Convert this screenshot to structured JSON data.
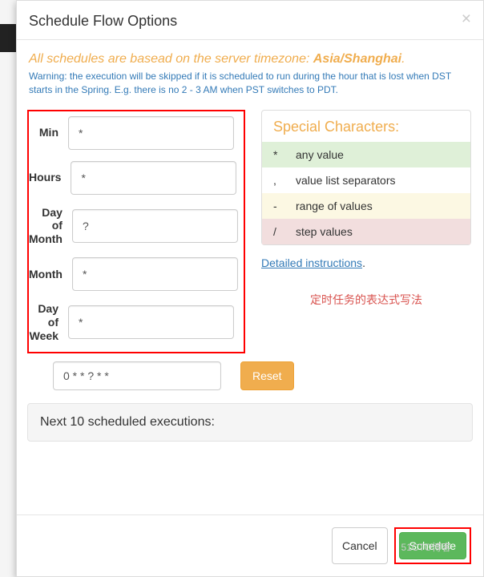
{
  "modal": {
    "title": "Schedule Flow Options",
    "close": "×"
  },
  "notice": {
    "tz_prefix": "All schedules are basead on the server timezone: ",
    "tz_name": "Asia/Shanghai",
    "tz_suffix": ".",
    "dst_warning": "Warning: the execution will be skipped if it is scheduled to run during the hour that is lost when DST starts in the Spring. E.g. there is no 2 - 3 AM when PST switches to PDT."
  },
  "cron": {
    "fields": [
      {
        "label": "Min",
        "value": "*"
      },
      {
        "label": "Hours",
        "value": "*"
      },
      {
        "label": "Day of Month",
        "value": "?"
      },
      {
        "label": "Month",
        "value": "*"
      },
      {
        "label": "Day of Week",
        "value": "*"
      }
    ],
    "summary": "0 * * ? * *",
    "reset_label": "Reset"
  },
  "special": {
    "title": "Special Characters:",
    "rows": [
      {
        "char": "*",
        "desc": "any value"
      },
      {
        "char": ",",
        "desc": "value list separators"
      },
      {
        "char": "-",
        "desc": "range of values"
      },
      {
        "char": "/",
        "desc": "step values"
      }
    ],
    "link": "Detailed instructions",
    "link_suffix": "."
  },
  "annotation": "定时任务的表达式写法",
  "next_panel": "Next 10 scheduled executions:",
  "footer": {
    "cancel": "Cancel",
    "schedule": "Schedule"
  },
  "watermark": "51CTO博客"
}
